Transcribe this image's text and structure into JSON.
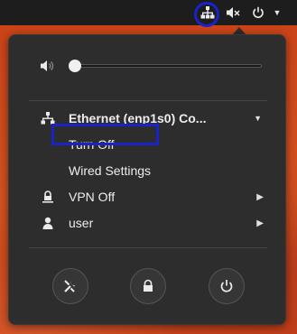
{
  "topbar": {
    "network_icon": "network-wired-icon",
    "sound_icon": "audio-muted-icon",
    "power_icon": "power-icon",
    "menu_caret": "▼"
  },
  "menu": {
    "volume": {
      "icon": "speaker-icon",
      "level": 0.0
    },
    "ethernet": {
      "icon": "network-wired-icon",
      "title": "Ethernet (enp1s0) Co...",
      "turn_off": "Turn Off",
      "settings": "Wired Settings"
    },
    "vpn": {
      "icon": "vpn-lock-icon",
      "label": "VPN Off"
    },
    "user": {
      "icon": "user-icon",
      "label": "user"
    },
    "buttons": {
      "settings_icon": "settings-tools-icon",
      "lock_icon": "lock-icon",
      "power_icon": "power-icon"
    }
  },
  "annotations": {
    "highlight_color": "#1a23c8"
  }
}
